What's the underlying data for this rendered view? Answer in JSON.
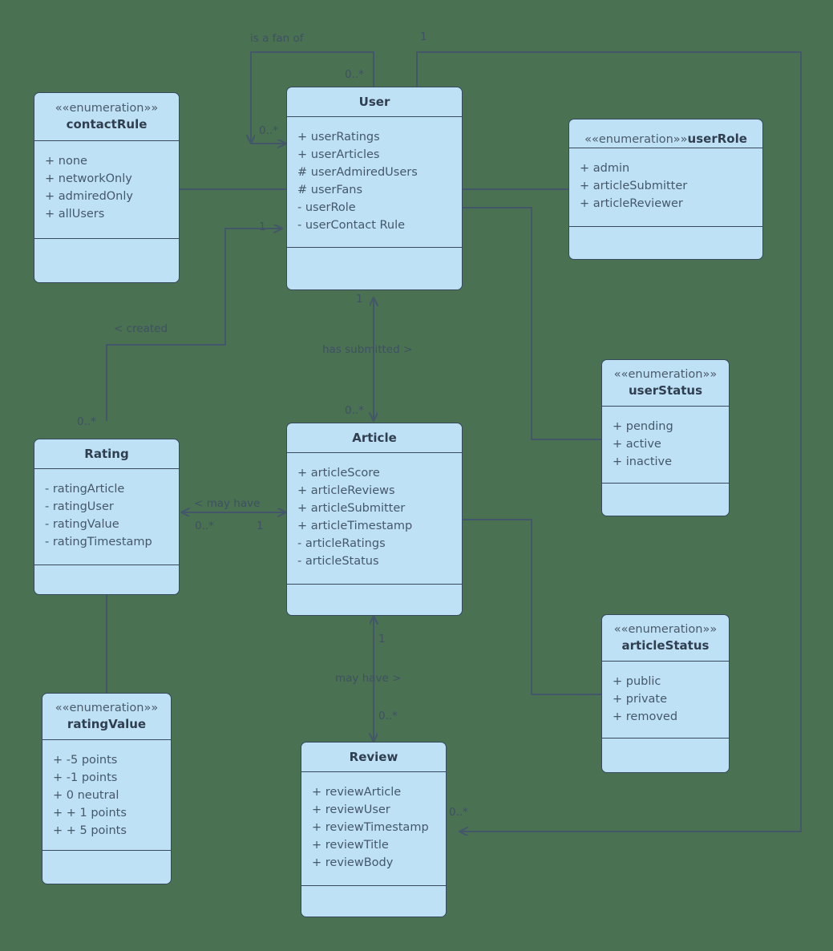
{
  "diagram": {
    "type": "uml-class-diagram",
    "background_color": "#4a7152",
    "class_fill_color": "#bfe1f6",
    "class_border_color": "#37495c",
    "line_color": "#44566a"
  },
  "classes": [
    {
      "id": "contactRule",
      "stereotype": "««enumeration»»",
      "name": "contactRule",
      "attributes": [
        "+ none",
        "+ networkOnly",
        "+ admiredOnly",
        "+ allUsers"
      ],
      "methods": []
    },
    {
      "id": "User",
      "stereotype": "",
      "name": "User",
      "attributes": [
        "+ userRatings",
        "+ userArticles",
        "# userAdmiredUsers",
        "# userFans",
        "- userRole",
        "- userContact Rule"
      ],
      "methods": []
    },
    {
      "id": "userRole",
      "stereotype": "««enumeration»»",
      "name": "userRole",
      "attributes": [
        "+ admin",
        "+ articleSubmitter",
        "+ articleReviewer"
      ],
      "methods": []
    },
    {
      "id": "userStatus",
      "stereotype": "««enumeration»»",
      "name": "userStatus",
      "attributes": [
        "+ pending",
        "+ active",
        "+ inactive"
      ],
      "methods": []
    },
    {
      "id": "Rating",
      "stereotype": "",
      "name": "Rating",
      "attributes": [
        "- ratingArticle",
        "- ratingUser",
        "- ratingValue",
        "- ratingTimestamp"
      ],
      "methods": []
    },
    {
      "id": "Article",
      "stereotype": "",
      "name": "Article",
      "attributes": [
        "+ articleScore",
        "+ articleReviews",
        "+ articleSubmitter",
        "+ articleTimestamp",
        "- articleRatings",
        "- articleStatus"
      ],
      "methods": []
    },
    {
      "id": "articleStatus",
      "stereotype": "««enumeration»»",
      "name": "articleStatus",
      "attributes": [
        "+ public",
        "+ private",
        "+ removed"
      ],
      "methods": []
    },
    {
      "id": "ratingValue",
      "stereotype": "««enumeration»»",
      "name": "ratingValue",
      "attributes": [
        "+ -5 points",
        "+ -1 points",
        "+ 0 neutral",
        "+ + 1 points",
        "+ + 5 points"
      ],
      "methods": []
    },
    {
      "id": "Review",
      "stereotype": "",
      "name": "Review",
      "attributes": [
        "+ reviewArticle",
        "+ reviewUser",
        "+ reviewTimestamp",
        "+ reviewTitle",
        "+ reviewBody"
      ],
      "methods": []
    }
  ],
  "relationships": [
    {
      "id": "fan",
      "label": "is a fan of",
      "source": "User",
      "target": "User",
      "source_multiplicity": "0..*",
      "target_multiplicity": "0..*"
    },
    {
      "id": "created",
      "label": "< created",
      "source": "Rating",
      "target": "User",
      "source_multiplicity": "0..*",
      "target_multiplicity": "1"
    },
    {
      "id": "submitted",
      "label": "has submitted >",
      "source": "User",
      "target": "Article",
      "source_multiplicity": "1",
      "target_multiplicity": "0..*"
    },
    {
      "id": "rating_article",
      "label": "< may have",
      "source": "Rating",
      "target": "Article",
      "source_multiplicity": "0..*",
      "target_multiplicity": "1"
    },
    {
      "id": "article_review",
      "label": "may have >",
      "source": "Article",
      "target": "Review",
      "source_multiplicity": "1",
      "target_multiplicity": "0..*"
    },
    {
      "id": "user_review",
      "label": "",
      "source": "User",
      "target": "Review",
      "source_multiplicity": "1",
      "target_multiplicity": "0..*"
    },
    {
      "id": "contactrule_userrole",
      "label": "",
      "source": "contactRule",
      "target": "userRole",
      "source_multiplicity": "",
      "target_multiplicity": ""
    },
    {
      "id": "user_userstatus",
      "label": "",
      "source": "User",
      "target": "userStatus",
      "source_multiplicity": "",
      "target_multiplicity": ""
    },
    {
      "id": "article_articlestatus",
      "label": "",
      "source": "Article",
      "target": "articleStatus",
      "source_multiplicity": "",
      "target_multiplicity": ""
    },
    {
      "id": "rating_ratingvalue",
      "label": "",
      "source": "Rating",
      "target": "ratingValue",
      "source_multiplicity": "",
      "target_multiplicity": ""
    }
  ],
  "labels": {
    "is_a_fan_of": "is a fan of",
    "created": "< created",
    "has_submitted": "has submitted >",
    "may_have_left": "< may have",
    "may_have_down": "may have >"
  },
  "multiplicities": {
    "fan_top": "0..*",
    "fan_left": "0..*",
    "user_top_right": "1",
    "created_user": "1",
    "created_rating": "0..*",
    "submitted_user": "1",
    "submitted_article": "0..*",
    "rating_side": "0..*",
    "article_side": "1",
    "article_review_top": "1",
    "article_review_bottom": "0..*",
    "review_user": "0..*"
  }
}
